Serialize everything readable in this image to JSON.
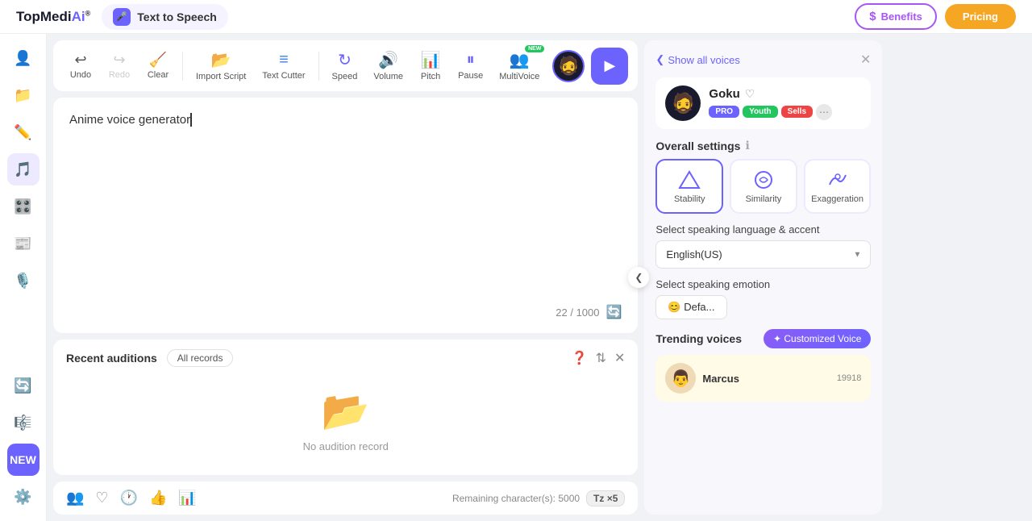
{
  "header": {
    "logo": "TopMediAi",
    "logo_reg": "®",
    "app_name": "Text to Speech",
    "benefits_label": "Benefits",
    "pricing_label": "Pricing"
  },
  "toolbar": {
    "undo_label": "Undo",
    "redo_label": "Redo",
    "clear_label": "Clear",
    "import_label": "Import Script",
    "textcutter_label": "Text Cutter",
    "speed_label": "Speed",
    "volume_label": "Volume",
    "pitch_label": "Pitch",
    "pause_label": "Pause",
    "multivoice_label": "MultiVoice",
    "new_badge": "NEW",
    "play_icon": "▶"
  },
  "editor": {
    "text": "Anime voice generator",
    "char_current": "22",
    "char_max": "1000"
  },
  "recent": {
    "title": "Recent auditions",
    "all_records": "All records",
    "empty_text": "No audition record"
  },
  "bottom": {
    "remaining_label": "Remaining character(s): 5000",
    "tz_badge": "Tz ×5"
  },
  "right_panel": {
    "show_all_voices": "Show all voices",
    "voice_name": "Goku",
    "badge_pro": "PRO",
    "badge_youth": "Youth",
    "badge_sells": "Sells",
    "settings_title": "Overall settings",
    "stability_label": "Stability",
    "similarity_label": "Similarity",
    "exaggeration_label": "Exaggeration",
    "lang_section": "Select speaking language & accent",
    "lang_value": "English(US)",
    "emotion_section": "Select speaking emotion",
    "emotion_value": "😊 Defa...",
    "trending_title": "Trending voices",
    "customized_btn": "✦ Customized Voice",
    "trending_voice_name": "Marcus",
    "trending_voice_count": "19918"
  }
}
